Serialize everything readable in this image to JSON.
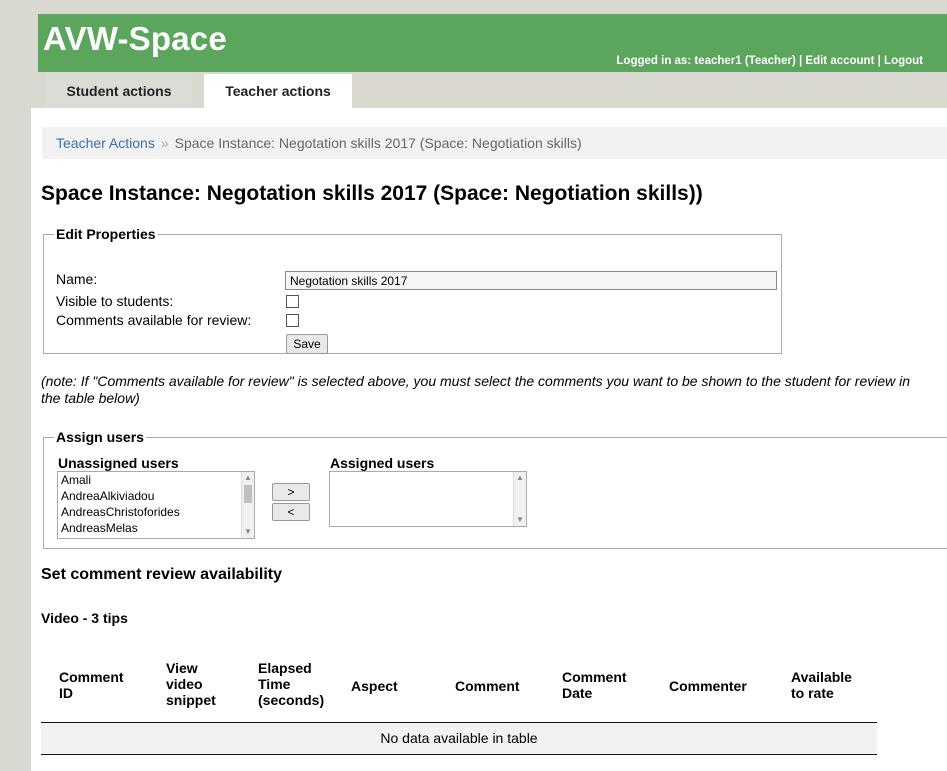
{
  "app": {
    "brand": "AVW-Space"
  },
  "user": {
    "logged_in_label": "Logged in as: teacher1 (Teacher)",
    "separator": "|",
    "edit_account": "Edit account",
    "logout": "Logout"
  },
  "tabs": [
    {
      "label": "Student actions",
      "active": false
    },
    {
      "label": "Teacher actions",
      "active": true
    }
  ],
  "breadcrumb": {
    "link": "Teacher Actions",
    "separator": "»",
    "current": "Space Instance: Negotation skills 2017 (Space: Negotiation skills)"
  },
  "page_title": "Space Instance: Negotation skills 2017 (Space: Negotiation skills))",
  "edit_properties": {
    "legend": "Edit Properties",
    "name_label": "Name:",
    "name_value": "Negotation skills 2017",
    "visible_label": "Visible to students:",
    "visible_checked": false,
    "comments_label": "Comments available for review:",
    "comments_checked": false,
    "save_label": "Save"
  },
  "note": "(note: If \"Comments available for review\" is selected above, you must select the comments you want to be shown to the student for review in the table below)",
  "assign_users": {
    "legend": "Assign users",
    "unassigned_title": "Unassigned users",
    "assigned_title": "Assigned users",
    "unassigned": [
      "Amali",
      "AndreaAlkiviadou",
      "AndreasChristoforides",
      "AndreasMelas"
    ],
    "assigned": [],
    "add_label": ">",
    "remove_label": "<"
  },
  "review": {
    "title": "Set comment review availability",
    "video_title": "Video - 3 tips",
    "columns": [
      {
        "l1": "Comment",
        "l2": "ID",
        "l3": ""
      },
      {
        "l1": "View",
        "l2": "video",
        "l3": "snippet"
      },
      {
        "l1": "Elapsed",
        "l2": "Time",
        "l3": "(seconds)",
        "l4": ""
      },
      {
        "l1": "Aspect",
        "l2": "",
        "l3": ""
      },
      {
        "l1": "Comment",
        "l2": "",
        "l3": ""
      },
      {
        "l1": "Comment",
        "l2": "Date",
        "l3": ""
      },
      {
        "l1": "Commenter",
        "l2": "",
        "l3": ""
      },
      {
        "l1": "Available",
        "l2": "to rate",
        "l3": ""
      }
    ],
    "empty_message": "No data available in table"
  },
  "colors": {
    "header_green": "#5ba55d",
    "link_blue": "#3a6ea8",
    "page_bg": "#d9d9d2"
  }
}
